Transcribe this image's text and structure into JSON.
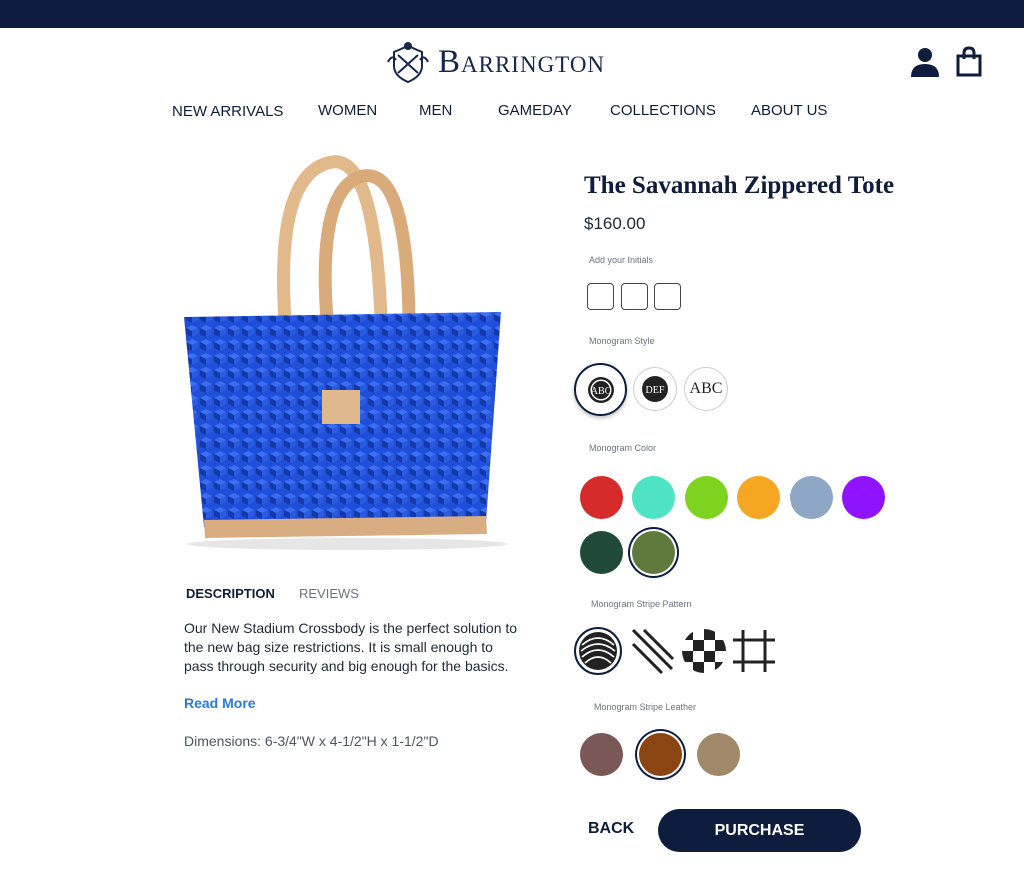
{
  "brand": {
    "name": "Barrington"
  },
  "header": {
    "icons": [
      "user-icon",
      "shopping-bag-icon"
    ]
  },
  "nav": [
    "NEW ARRIVALS",
    "WOMEN",
    "MEN",
    "GAMEDAY",
    "COLLECTIONS",
    "ABOUT US"
  ],
  "product": {
    "title": "The Savannah Zippered Tote",
    "price": "$160.00",
    "tabs": {
      "description": "DESCRIPTION",
      "reviews": "REVIEWS"
    },
    "description": "Our New Stadium Crossbody is the perfect solution to the new bag size restrictions. It is small enough to pass through security and big enough for the basics.",
    "read_more": "Read More",
    "dimensions": "Dimensions: 6-3/4\"W x 4-1/2\"H x 1-1/2\"D"
  },
  "options": {
    "initials_label": "Add your Initials",
    "initials_values": [
      "",
      "",
      ""
    ],
    "style_label": "Monogram Style",
    "styles": [
      "ABC",
      "DEF",
      "ABC"
    ],
    "selected_style": 0,
    "color_label": "Monogram Color",
    "colors": [
      "#d62b2b",
      "#4ee3c4",
      "#7ed321",
      "#f5a623",
      "#8fa6c4",
      "#9013fe",
      "#1f4a3a",
      "#5f7a3c"
    ],
    "selected_color": 7,
    "stripe_label": "Monogram Stripe Pattern",
    "stripes": [
      "wave-pattern-icon",
      "diagonal-stripes-icon",
      "checker-pattern-icon",
      "grid-pattern-icon"
    ],
    "selected_stripe": 0,
    "leather_label": "Monogram Stripe Leather",
    "leathers": [
      "#7a5856",
      "#8b4513",
      "#a08868"
    ],
    "selected_leather": 1
  },
  "actions": {
    "back": "BACK",
    "purchase": "PURCHASE"
  }
}
